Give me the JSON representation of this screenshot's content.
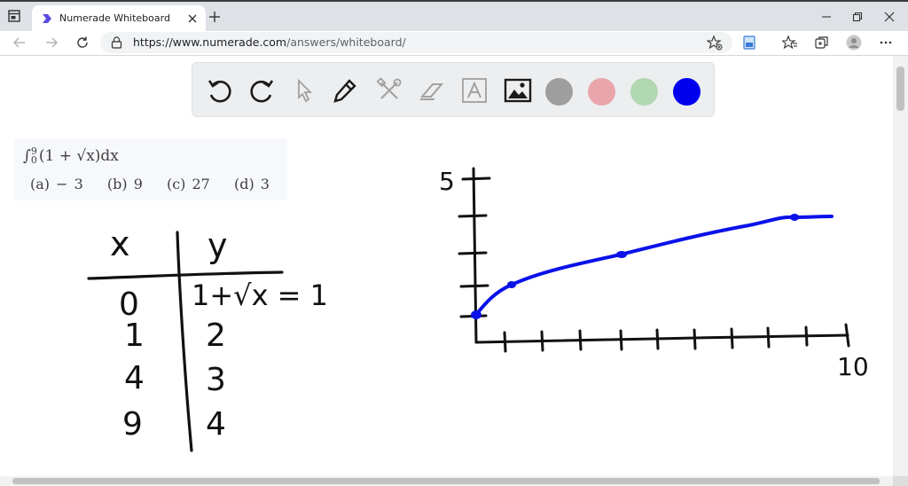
{
  "browser": {
    "tab_title": "Numerade Whiteboard",
    "url_host": "https://www.numerade.com",
    "url_path": "/answers/whiteboard/",
    "icons": [
      "window-menu-icon",
      "numerade-favicon",
      "tab-close-icon",
      "new-tab-icon",
      "minimize-icon",
      "restore-icon",
      "close-window-icon",
      "back-icon",
      "forward-icon",
      "refresh-icon",
      "lock-icon",
      "add-favorite-icon",
      "extension-icon",
      "favorites-icon",
      "collections-icon",
      "profile-icon",
      "more-icon"
    ]
  },
  "whiteboard": {
    "tools": [
      "undo-icon",
      "redo-icon",
      "pointer-icon",
      "pen-icon",
      "tools-icon",
      "eraser-icon",
      "text-icon",
      "image-icon"
    ],
    "colors": [
      "#9e9e9e",
      "#e8a6ab",
      "#b2d8b2",
      "#0000ee"
    ],
    "active_color": "#0000ee"
  },
  "question": {
    "integral_upper": "9",
    "integral_lower": "0",
    "integral_body": "(1 + √x)dx",
    "options": [
      "(a) − 3",
      "(b) 9",
      "(c) 27",
      "(d) 3"
    ]
  },
  "handwriting": {
    "table_header_x": "x",
    "table_header_y": "y",
    "row0_eq": "1+√x = 1",
    "x_values": [
      "0",
      "1",
      "4",
      "9"
    ],
    "y_values": [
      "1",
      "2",
      "3",
      "4"
    ],
    "graph_y_label": "5",
    "graph_x_label": "10"
  }
}
